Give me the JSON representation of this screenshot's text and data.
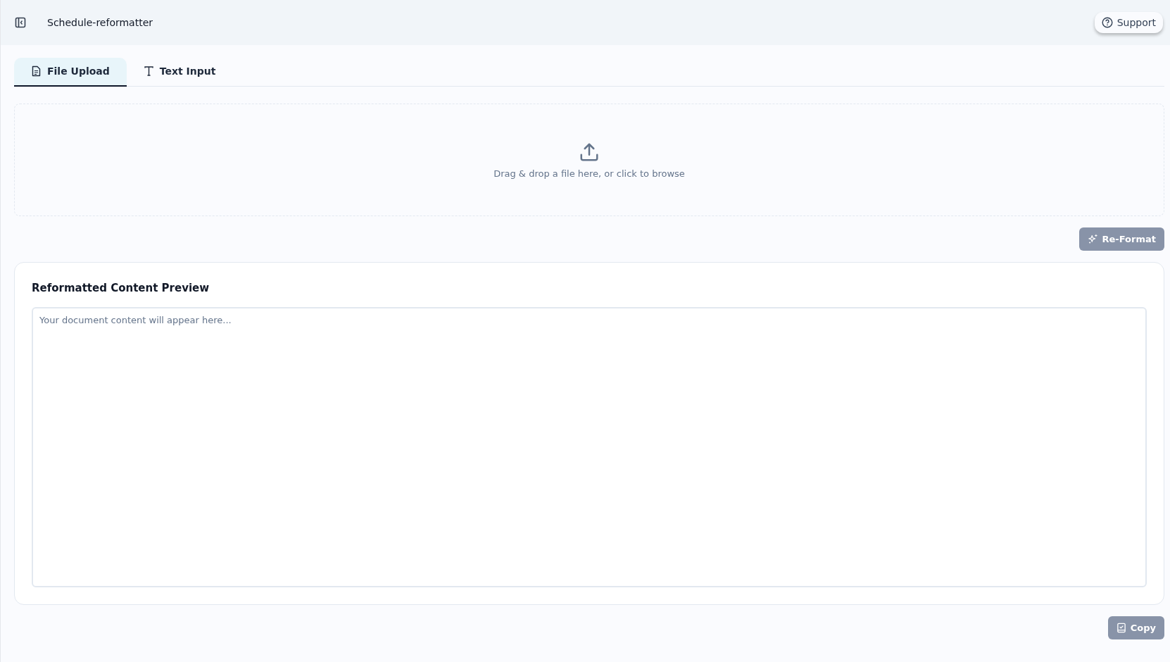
{
  "header": {
    "title": "Schedule-reformatter",
    "support_button": {
      "label": "Support"
    }
  },
  "tabs": [
    {
      "kind": "file",
      "label": "File Upload",
      "selected": true
    },
    {
      "kind": "text",
      "label": "Text Input",
      "selected": false
    }
  ],
  "dropzone": {
    "text": "Drag & drop a file here, or click to browse"
  },
  "reformat_button": {
    "label": "Re-Format",
    "disabled": true
  },
  "preview": {
    "title": "Reformatted Content Preview",
    "placeholder": "Your document content will appear here..."
  },
  "copy_button": {
    "label": "Copy",
    "disabled": true
  }
}
